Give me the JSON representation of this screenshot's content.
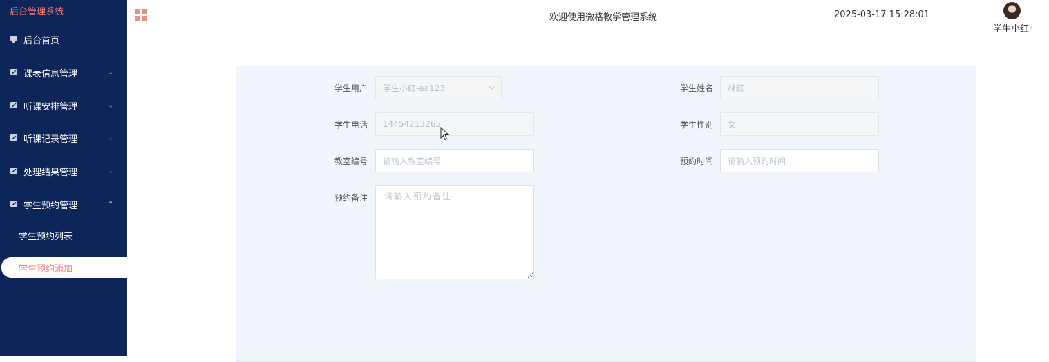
{
  "sidebar": {
    "brand": "后台管理系统",
    "items": [
      {
        "label": "后台首页",
        "icon": "monitor-icon"
      },
      {
        "label": "课表信息管理",
        "icon": "chart-icon"
      },
      {
        "label": "听课安排管理",
        "icon": "chart-icon"
      },
      {
        "label": "听课记录管理",
        "icon": "chart-icon"
      },
      {
        "label": "处理结果管理",
        "icon": "chart-icon"
      },
      {
        "label": "学生预约管理",
        "icon": "chart-icon"
      }
    ],
    "submenu": [
      "学生预约列表",
      "学生预约添加"
    ]
  },
  "header": {
    "welcome": "欢迎使用微格教学管理系统",
    "datetime": "2025-03-17 15:28:01",
    "username": "学生小红"
  },
  "form": {
    "student_user_label": "学生用户",
    "student_user_value": "学生小红-aa123",
    "student_name_label": "学生姓名",
    "student_name_value": "林红",
    "student_phone_label": "学生电话",
    "student_phone_value": "14454213265",
    "student_gender_label": "学生性别",
    "student_gender_value": "女",
    "classroom_label": "教室编号",
    "classroom_placeholder": "请输入教室编号",
    "time_label": "预约时间",
    "time_placeholder": "请输入预约时间",
    "remark_label": "预约备注",
    "remark_placeholder": "请输入预约备注"
  },
  "colors": {
    "sidebar_bg": "#0e2559",
    "accent": "#f08080",
    "panel_bg": "#f0f6fc"
  }
}
